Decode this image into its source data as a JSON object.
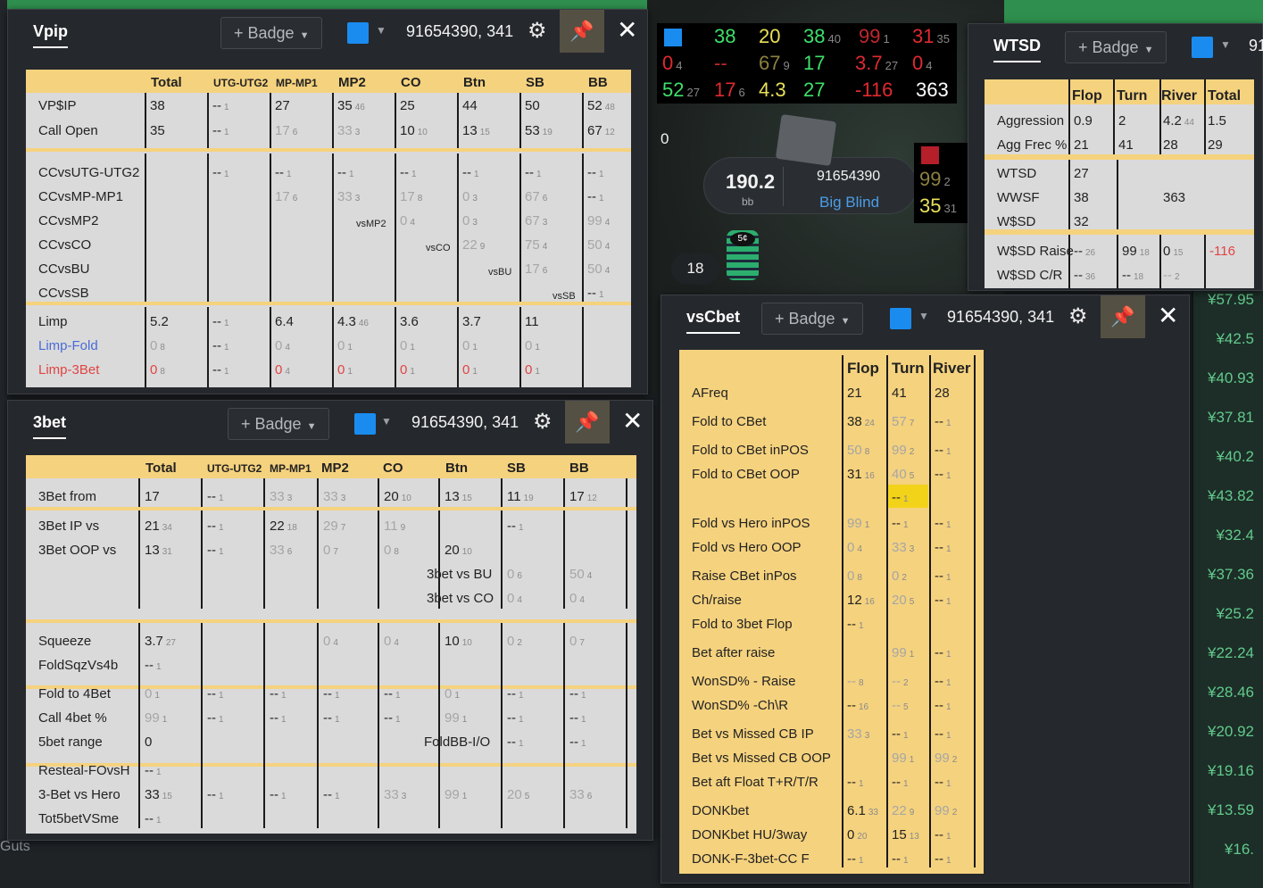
{
  "table_bg": {
    "pot": "190.2",
    "pot_unit": "bb",
    "player_id": "91654390",
    "position": "Big Blind",
    "chip_label": "5¢",
    "stack_left": "18",
    "zero_label": "0"
  },
  "side_prices": [
    "¥57.95",
    "¥42.5",
    "¥40.93",
    "¥37.81",
    "¥40.2",
    "¥43.82",
    "¥32.4",
    "¥37.36",
    "¥25.2",
    "¥22.24",
    "¥28.46",
    "¥20.92",
    "¥19.16",
    "¥13.59",
    "¥16."
  ],
  "bottom_label": "Guts",
  "hud_top": {
    "r1": [
      {
        "v": "38",
        "c": "#3ee06a"
      },
      {
        "v": "20",
        "c": "#e8e05a"
      },
      {
        "v": "38",
        "c": "#3ee06a",
        "s": "40"
      },
      {
        "v": "99",
        "c": "#c0282d",
        "s": "1"
      },
      {
        "v": "31",
        "c": "#e02a2f",
        "s": "35"
      }
    ],
    "r2": [
      {
        "v": "0",
        "c": "#e02a2f",
        "s": "4"
      },
      {
        "v": "--",
        "c": "#c0282d"
      },
      {
        "v": "67",
        "c": "#8c8140",
        "s": "9"
      },
      {
        "v": "17",
        "c": "#3ee06a"
      },
      {
        "v": "3.7",
        "c": "#e02a2f",
        "s": "27"
      },
      {
        "v": "0",
        "c": "#e02a2f",
        "s": "4"
      }
    ],
    "r3": [
      {
        "v": "52",
        "c": "#3ee06a",
        "s": "27"
      },
      {
        "v": "17",
        "c": "#e02a2f",
        "s": "6"
      },
      {
        "v": "4.3",
        "c": "#e8e05a"
      },
      {
        "v": "27",
        "c": "#3ee06a"
      },
      {
        "v": "-116",
        "c": "#e02a2f"
      },
      {
        "v": "363",
        "c": "#ffffff"
      }
    ]
  },
  "hud_side": {
    "a": "99",
    "a_sub": "2",
    "b": "35",
    "b_sub": "31"
  },
  "vpip": {
    "title": "Vpip",
    "badge": "+ Badge",
    "id": "91654390, 341"
  },
  "threebet": {
    "title": "3bet",
    "badge": "+ Badge",
    "id": "91654390, 341"
  },
  "wtsd": {
    "title": "WTSD",
    "badge": "+ Badge",
    "id": "91"
  },
  "vscbet": {
    "title": "vsCbet",
    "badge": "+ Badge",
    "id": "91654390, 341"
  }
}
